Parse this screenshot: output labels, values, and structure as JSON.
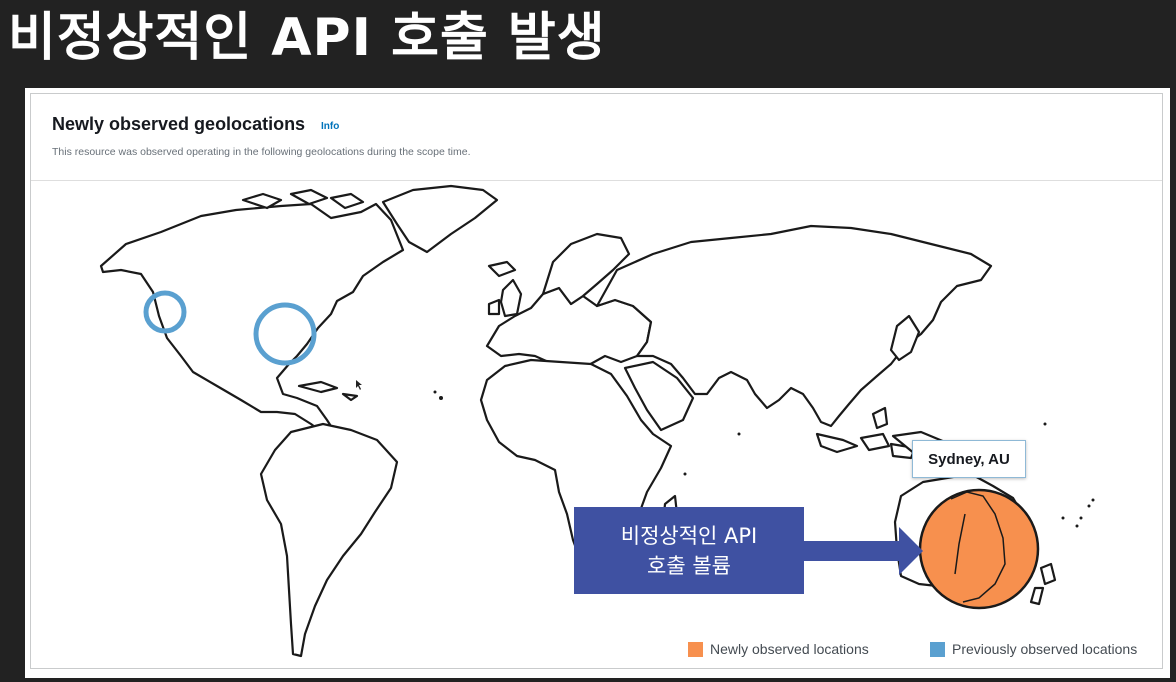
{
  "slide": {
    "title": "비정상적인 API 호출 발생"
  },
  "panel": {
    "heading": "Newly observed geolocations",
    "info_label": "Info",
    "description": "This resource was observed operating in the following geolocations during the scope time."
  },
  "map": {
    "tooltip": "Sydney, AU",
    "callout": {
      "line1": "비정상적인 API",
      "line2": "호출 볼륨"
    }
  },
  "legend": {
    "new": {
      "label": "Newly observed locations",
      "color": "#f7904e"
    },
    "previous": {
      "label": "Previously observed locations",
      "color": "#5aa0d0"
    }
  },
  "colors": {
    "callout_bg": "#3f51a2",
    "info_link": "#0073bb"
  }
}
